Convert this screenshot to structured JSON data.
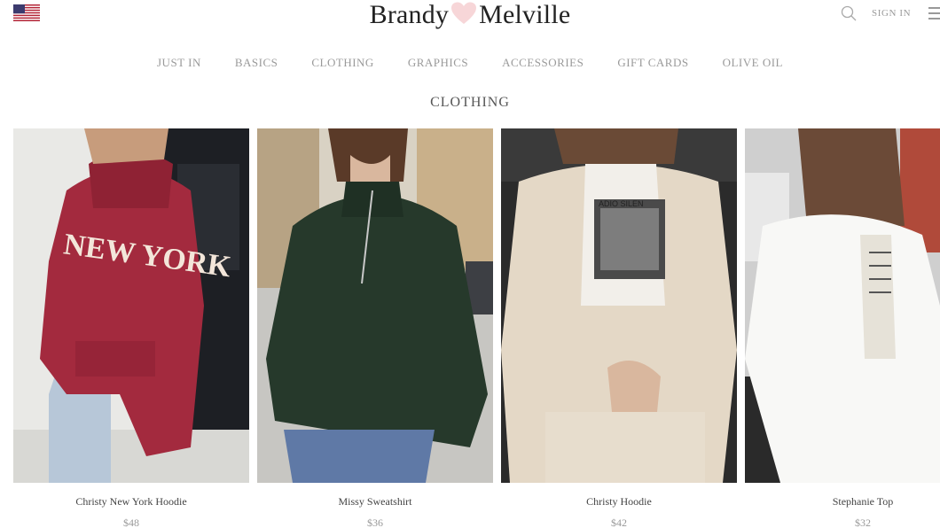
{
  "header": {
    "brand_left": "Brandy",
    "brand_right": "Melville",
    "sign_in": "SIGN IN",
    "icons": [
      "us-flag-icon",
      "heart-icon",
      "search-icon",
      "hamburger-menu-icon"
    ],
    "heart_color": "#f7d6d8"
  },
  "nav": {
    "items": [
      {
        "label": "JUST IN"
      },
      {
        "label": "BASICS"
      },
      {
        "label": "CLOTHING"
      },
      {
        "label": "GRAPHICS"
      },
      {
        "label": "ACCESSORIES"
      },
      {
        "label": "GIFT CARDS"
      },
      {
        "label": "OLIVE OIL"
      }
    ]
  },
  "page_title": "CLOTHING",
  "products": [
    {
      "name": "Christy New York Hoodie",
      "price": "$48",
      "color": "#a32a3e"
    },
    {
      "name": "Missy Sweatshirt",
      "price": "$36",
      "color": "#26392b"
    },
    {
      "name": "Christy Hoodie",
      "price": "$42",
      "color": "#e4d8c6"
    },
    {
      "name": "Stephanie Top",
      "price": "$32",
      "color": "#f8f8f6"
    }
  ]
}
